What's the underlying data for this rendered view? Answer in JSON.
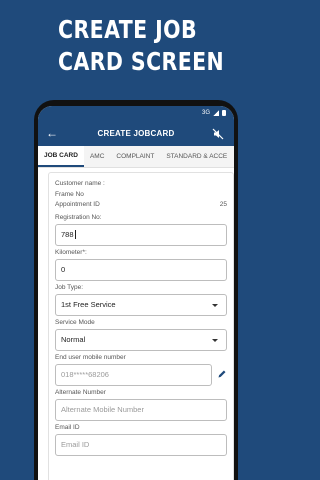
{
  "headline": {
    "line1": "CREATE JOB",
    "line2": "CARD SCREEN"
  },
  "statusbar": {
    "network": "3G"
  },
  "appbar": {
    "title": "CREATE JOBCARD",
    "back_icon": "←"
  },
  "tabs": [
    {
      "label": "JOB CARD"
    },
    {
      "label": "AMC"
    },
    {
      "label": "COMPLAINT"
    },
    {
      "label": "STANDARD & ACCE"
    }
  ],
  "info": {
    "customer_name_label": "Customer name :",
    "frame_no_label": "Frame No",
    "appointment_id_label": "Appointment ID",
    "appointment_id_value": "25"
  },
  "fields": {
    "registration": {
      "label": "Registration No:",
      "value": "788"
    },
    "kilometer": {
      "label": "Kilometer*:",
      "value": "0"
    },
    "job_type": {
      "label": "Job Type:",
      "value": "1st Free Service"
    },
    "service_mode": {
      "label": "Service Mode",
      "value": "Normal"
    },
    "mobile": {
      "label": "End user mobile number",
      "value": "018*****68206"
    },
    "alt_number": {
      "label": "Alternate Number",
      "placeholder": "Alternate Mobile Number"
    },
    "email": {
      "label": "Email ID",
      "placeholder": "Email ID"
    }
  },
  "colors": {
    "primary": "#1f4a7b"
  }
}
